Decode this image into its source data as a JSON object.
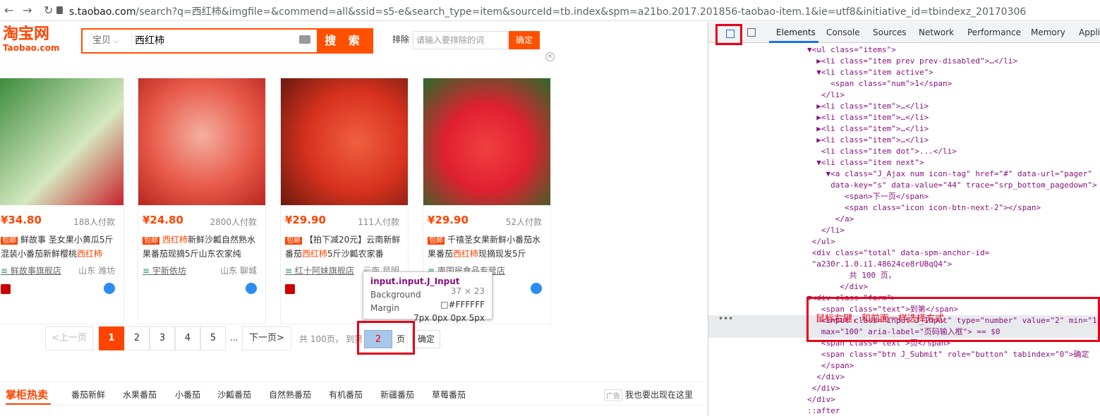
{
  "browser": {
    "back_icon": "←",
    "forward_icon": "→",
    "reload_icon": "↻",
    "lock_icon": "lock-icon",
    "url_host": "s.taobao.com",
    "url_path": "/search?q=西红柿&imgfile=&commend=all&ssid=s5-e&search_type=item&sourceId=tb.index&spm=a21bo.2017.201856-taobao-item.1&ie=utf8&initiative_id=tbindexz_20170306"
  },
  "header": {
    "logo_text": "淘宝网",
    "logo_sub": "Taobao.com",
    "category": "宝贝",
    "query": "西红柿",
    "search_button": "搜 索",
    "exclude_label": "排除",
    "exclude_placeholder": "请输入要排除的词",
    "exclude_button": "确定",
    "close": "×"
  },
  "products": [
    {
      "price": "¥34.80",
      "sales": "188人付款",
      "tag": "包邮",
      "title_pre": "鲜故事 圣女果小黄瓜5斤混装小番茄新鲜樱桃",
      "title_hl": "西红柿",
      "title_post": "",
      "shop": "鲜故事旗舰店",
      "location": "山东 潍坊",
      "img_color": "#3a8a3a"
    },
    {
      "price": "¥24.80",
      "sales": "2800人付款",
      "tag": "包邮",
      "title_pre": "",
      "title_hl": "西红柿",
      "title_post": "新鲜沙瓤自然熟水果番茄现摘5斤山东农家纯",
      "shop": "宇新依坊",
      "location": "山东 聊城",
      "img_color": "#e85a4a"
    },
    {
      "price": "¥29.90",
      "sales": "111人付款",
      "tag": "包邮",
      "title_pre": "【拍下减20元】云南新鲜番茄",
      "title_hl": "西红柿",
      "title_post": "5斤沙瓤农家番",
      "shop": "红十阿妹旗舰店",
      "location": "云南 昆明",
      "img_color": "#d8321e"
    },
    {
      "price": "¥29.90",
      "sales": "52人付款",
      "tag": "包邮",
      "title_pre": "千禧圣女果新鲜小番茄水果番茄",
      "title_hl": "西红柿",
      "title_post": "现摘现发5斤",
      "shop": "南国居食品专营店",
      "location": "",
      "img_color": "#e02030"
    }
  ],
  "pagination": {
    "prev": "<上一页",
    "pages": [
      "1",
      "2",
      "3",
      "4",
      "5"
    ],
    "ellipsis": "...",
    "next": "下一页>",
    "total_text": "共 100页，",
    "goto_text": "到第",
    "input_value": "2",
    "page_unit": "页",
    "confirm": "确定"
  },
  "tooltip": {
    "selector": "input.input.J_Input",
    "size": "37 × 23",
    "bg_label": "Background",
    "bg_value": "□#FFFFFF",
    "margin_label": "Margin",
    "margin_value": "7px 0px 0px 5px"
  },
  "hotbar": {
    "title": "掌柜热卖",
    "items": [
      "番茄新鲜",
      "水果番茄",
      "小番茄",
      "沙瓤番茄",
      "自然熟番茄",
      "有机番茄",
      "新疆番茄",
      "草莓番茄"
    ],
    "ad_label": "广告",
    "ad_text": "我也要出现在这里"
  },
  "devtools": {
    "tabs": [
      "Elements",
      "Console",
      "Sources",
      "Network",
      "Performance",
      "Memory",
      "Applic"
    ],
    "annotation": "鼠标右键，和前面一样选择方式",
    "lines": [
      "▼<ul class=\"items\">",
      "  ▶<li class=\"item prev prev-disabled\">…</li>",
      "  ▼<li class=\"item active\">",
      "     <span class=\"num\">1</span>",
      "   </li>",
      "  ▶<li class=\"item\">…</li>",
      "  ▶<li class=\"item\">…</li>",
      "  ▶<li class=\"item\">…</li>",
      "  ▶<li class=\"item\">…</li>",
      "   <li class=\"item dot\">...</li>",
      "  ▼<li class=\"item next\">",
      "    ▼<a class=\"J_Ajax num icon-tag\" href=\"#\" data-url=\"pager\"",
      "     data-key=\"s\" data-value=\"44\" trace=\"srp_bottom_pagedown\">",
      "        <span>下一页</span>",
      "        <span class=\"icon icon-btn-next-2\"></span>",
      "      </a>",
      "   </li>",
      " </ul>",
      " <div class=\"total\" data-spm-anchor-id=",
      " \"a230r.1.0.i1.48624ce8rUBqQ4\">",
      "         共 100 页，",
      "       </div>",
      "▼<div class=\"form\">",
      "   <span class=\"text\">到第</span>",
      "   <input class=\"input J_Input\" type=\"number\" value=\"2\" min=\"1\"",
      "   max=\"100\" aria-label=\"页码输入框\"> == $0",
      "   <span class=\"text\">页</span>",
      "   <span class=\"btn J_Submit\" role=\"button\" tabindex=\"0\">确定",
      "   </span>",
      "  </div>",
      " </div>",
      "</div>",
      "::after"
    ]
  }
}
